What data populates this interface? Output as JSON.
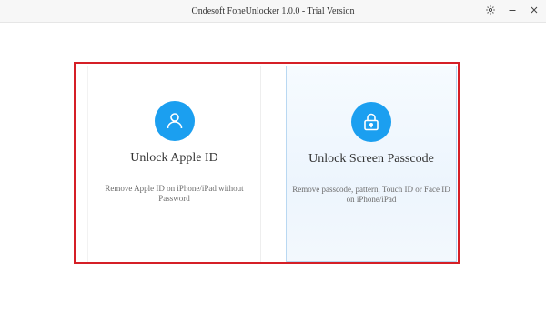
{
  "window": {
    "title": "Ondesoft FoneUnlocker 1.0.0 - Trial Version",
    "controls": [
      {
        "icon": "gear-icon",
        "glyph": "⚙"
      },
      {
        "icon": "minimize-icon",
        "glyph": "—"
      },
      {
        "icon": "close-icon",
        "glyph": "✕"
      }
    ]
  },
  "options": [
    {
      "icon": "user-icon",
      "title": "Unlock Apple ID",
      "description": "Remove Apple ID on iPhone/iPad without Password"
    },
    {
      "icon": "lock-icon",
      "title": "Unlock Screen Passcode",
      "description": "Remove passcode, pattern, Touch ID or Face ID on iPhone/iPad"
    }
  ],
  "colors": {
    "accent": "#1b9ff0",
    "highlight": "#d51f26",
    "selected_border": "#b9d8f2"
  }
}
